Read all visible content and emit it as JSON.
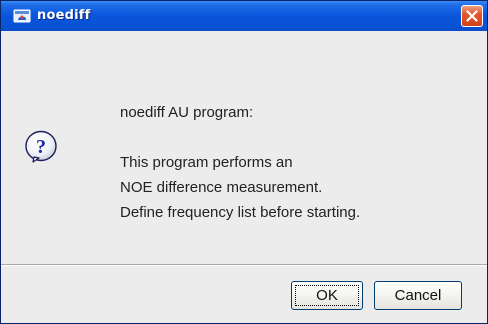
{
  "window": {
    "title": "noediff",
    "title_icon": "java-app-icon",
    "close_icon": "close-icon"
  },
  "dialog": {
    "icon": "question-icon",
    "message_lines": [
      "noediff AU program:",
      "This program performs an",
      "NOE difference measurement.",
      "Define frequency list before starting."
    ]
  },
  "buttons": {
    "ok_label": "OK",
    "cancel_label": "Cancel"
  },
  "colors": {
    "titlebar": "#0a55db",
    "close_button": "#e2572e",
    "dialog_background": "#ececec"
  }
}
